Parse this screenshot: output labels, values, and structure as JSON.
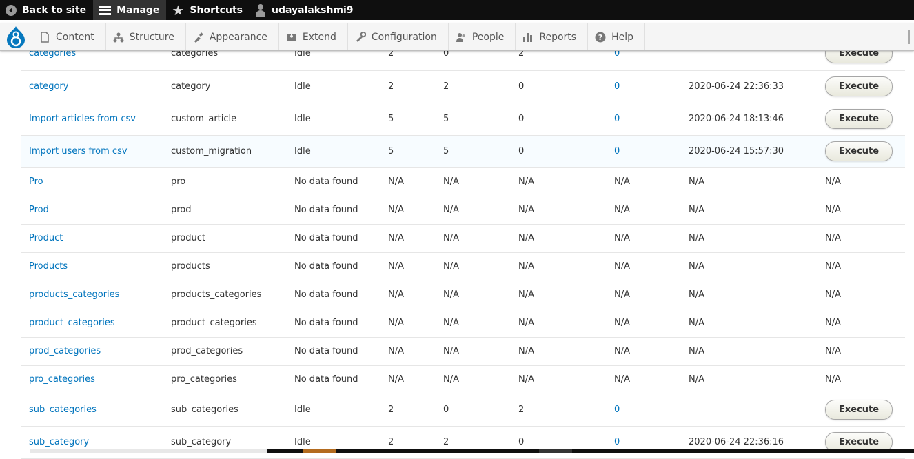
{
  "toolbar": {
    "back": "Back to site",
    "manage": "Manage",
    "shortcuts": "Shortcuts",
    "user": "udayalakshmi9"
  },
  "tray": {
    "items": [
      "Content",
      "Structure",
      "Appearance",
      "Extend",
      "Configuration",
      "People",
      "Reports",
      "Help"
    ]
  },
  "migrations": [
    {
      "label": "categories",
      "machine": "categories",
      "status": "Idle",
      "total": "2",
      "imported": "0",
      "unprocessed": "2",
      "messages": "0",
      "last": "",
      "op": "Execute"
    },
    {
      "label": "category",
      "machine": "category",
      "status": "Idle",
      "total": "2",
      "imported": "2",
      "unprocessed": "0",
      "messages": "0",
      "last": "2020-06-24 22:36:33",
      "op": "Execute"
    },
    {
      "label": "Import articles from csv",
      "machine": "custom_article",
      "status": "Idle",
      "total": "5",
      "imported": "5",
      "unprocessed": "0",
      "messages": "0",
      "last": "2020-06-24 18:13:46",
      "op": "Execute"
    },
    {
      "label": "Import users from csv",
      "machine": "custom_migration",
      "status": "Idle",
      "total": "5",
      "imported": "5",
      "unprocessed": "0",
      "messages": "0",
      "last": "2020-06-24 15:57:30",
      "op": "Execute"
    },
    {
      "label": "Pro",
      "machine": "pro",
      "status": "No data found",
      "total": "N/A",
      "imported": "N/A",
      "unprocessed": "N/A",
      "messages": "N/A",
      "last": "N/A",
      "op": "N/A"
    },
    {
      "label": "Prod",
      "machine": "prod",
      "status": "No data found",
      "total": "N/A",
      "imported": "N/A",
      "unprocessed": "N/A",
      "messages": "N/A",
      "last": "N/A",
      "op": "N/A"
    },
    {
      "label": "Product",
      "machine": "product",
      "status": "No data found",
      "total": "N/A",
      "imported": "N/A",
      "unprocessed": "N/A",
      "messages": "N/A",
      "last": "N/A",
      "op": "N/A"
    },
    {
      "label": "Products",
      "machine": "products",
      "status": "No data found",
      "total": "N/A",
      "imported": "N/A",
      "unprocessed": "N/A",
      "messages": "N/A",
      "last": "N/A",
      "op": "N/A"
    },
    {
      "label": "products_categories",
      "machine": "products_categories",
      "status": "No data found",
      "total": "N/A",
      "imported": "N/A",
      "unprocessed": "N/A",
      "messages": "N/A",
      "last": "N/A",
      "op": "N/A"
    },
    {
      "label": "product_categories",
      "machine": "product_categories",
      "status": "No data found",
      "total": "N/A",
      "imported": "N/A",
      "unprocessed": "N/A",
      "messages": "N/A",
      "last": "N/A",
      "op": "N/A"
    },
    {
      "label": "prod_categories",
      "machine": "prod_categories",
      "status": "No data found",
      "total": "N/A",
      "imported": "N/A",
      "unprocessed": "N/A",
      "messages": "N/A",
      "last": "N/A",
      "op": "N/A"
    },
    {
      "label": "pro_categories",
      "machine": "pro_categories",
      "status": "No data found",
      "total": "N/A",
      "imported": "N/A",
      "unprocessed": "N/A",
      "messages": "N/A",
      "last": "N/A",
      "op": "N/A"
    },
    {
      "label": "sub_categories",
      "machine": "sub_categories",
      "status": "Idle",
      "total": "2",
      "imported": "0",
      "unprocessed": "2",
      "messages": "0",
      "last": "",
      "op": "Execute"
    },
    {
      "label": "sub_category",
      "machine": "sub_category",
      "status": "Idle",
      "total": "2",
      "imported": "2",
      "unprocessed": "0",
      "messages": "0",
      "last": "2020-06-24 22:36:16",
      "op": "Execute"
    }
  ],
  "colors": {
    "link": "#0074bd",
    "toolbar": "#0f0f0f",
    "drupal_blue": "#0678be"
  },
  "icons": [
    "back-icon",
    "menu-icon",
    "star-icon",
    "user-icon",
    "drupal-logo",
    "content-icon",
    "structure-icon",
    "appearance-icon",
    "extend-icon",
    "configuration-icon",
    "people-icon",
    "reports-icon",
    "help-icon"
  ]
}
